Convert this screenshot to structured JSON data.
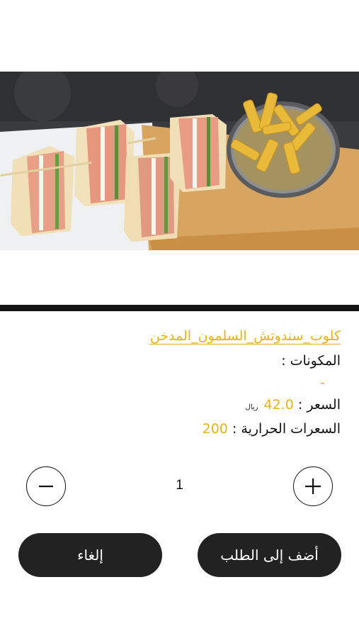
{
  "product": {
    "title": "كلوب_سندوتش_السلمون_المدخن",
    "ingredients_label": "المكونات :",
    "ingredients_value": "-",
    "price_label": "السعر :",
    "price_value": "42.0",
    "currency": "ريال",
    "calories_label": "السعرات الحرارية :",
    "calories_value": "200"
  },
  "quantity": {
    "value": "1",
    "decrease_icon": "minus-icon",
    "increase_icon": "plus-icon"
  },
  "actions": {
    "add_label": "أضف إلى الطلب",
    "cancel_label": "إلغاء"
  },
  "colors": {
    "accent": "#E8B21A",
    "button_bg": "#222222",
    "divider": "#141414"
  }
}
